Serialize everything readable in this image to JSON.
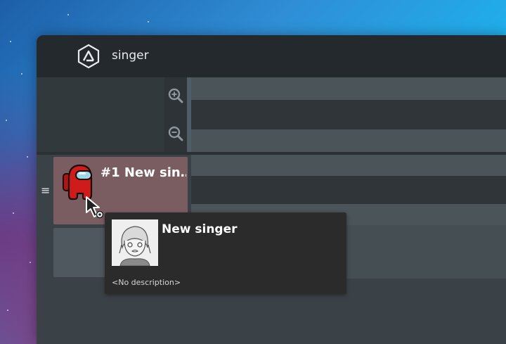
{
  "window": {
    "title": "singer"
  },
  "icons": {
    "logo": "triangle-hexagon-logo-icon",
    "zoom_in": "zoom-in-icon",
    "zoom_out": "zoom-out-icon",
    "drag": "drag-handle-icon",
    "cursor": "pointer-cursor-icon"
  },
  "tracks": [
    {
      "label": "#1 New sin…",
      "avatar": "red-crewmate-avatar"
    }
  ],
  "tooltip": {
    "name": "New singer",
    "description": "<No description>",
    "portrait": "singer-portrait-sketch"
  },
  "colors": {
    "titlebar": "#23292d",
    "window_bg": "#3b4247",
    "track_card_selected": "#7a5d60",
    "tooltip_bg": "#2b2b2b",
    "accent_divider": "#4f5d66"
  }
}
